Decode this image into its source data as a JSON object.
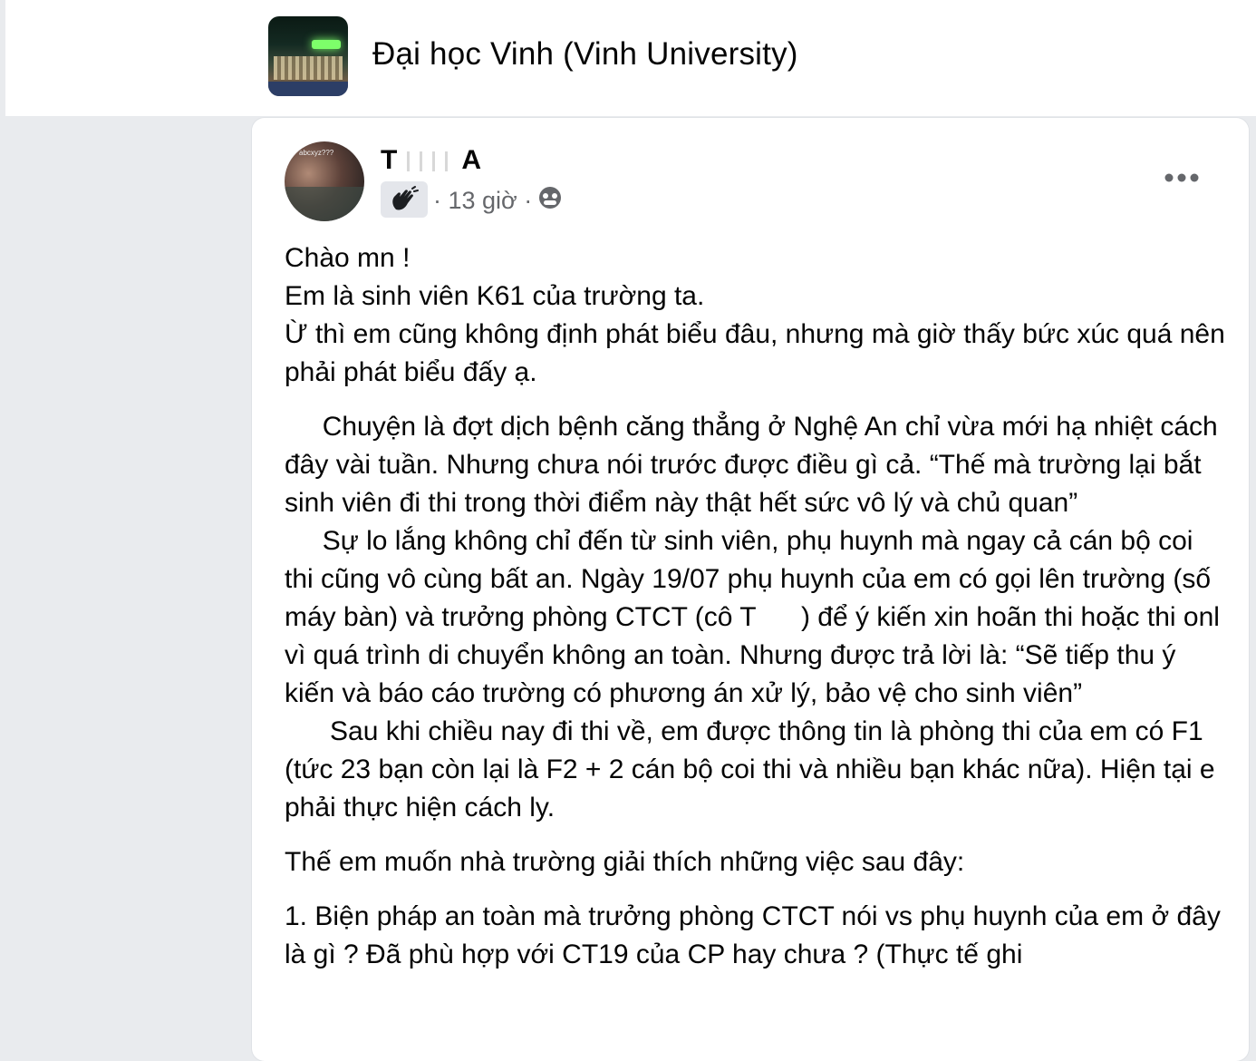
{
  "group": {
    "name": "Đại học Vinh (Vinh University)"
  },
  "post": {
    "author_name_start": "T",
    "author_name_end": "A",
    "avatar_overlay_text": "abcxyz???",
    "time": "· 13 giờ ·",
    "paragraphs": [
      "Chào mn !\nEm là sinh viên K61 của trường ta.\nỪ thì em cũng không định phát biểu đâu, nhưng mà giờ thấy bức xúc quá nên phải phát biểu đấy ạ.",
      "     Chuyện là đợt dịch bệnh căng thẳng ở Nghệ An chỉ vừa mới hạ nhiệt cách đây vài tuần. Nhưng chưa nói trước được điều gì cả. “Thế mà trường lại bắt sinh viên đi thi trong thời điểm này thật hết sức vô lý và chủ quan”\n     Sự lo lắng không chỉ đến từ sinh viên, phụ huynh mà ngay cả cán bộ coi thi cũng vô cùng bất an. Ngày 19/07 phụ huynh của em có gọi lên trường (số máy bàn) và trưởng phòng CTCT (cô T      ) để ý kiến xin hoãn thi hoặc thi onl vì quá trình di chuyển không an toàn. Nhưng được trả lời là: “Sẽ tiếp thu ý kiến và báo cáo trường có phương án xử lý, bảo vệ cho sinh viên”\n      Sau khi chiều nay đi thi về, em được thông tin là phòng thi của em có F1 (tức 23 bạn còn lại là F2 + 2 cán bộ coi thi và nhiều bạn khác nữa). Hiện tại e phải thực hiện cách ly.",
      "Thế em muốn nhà trường giải thích những việc sau đây:",
      "1. Biện pháp an toàn mà trưởng phòng CTCT nói vs phụ huynh của em ở đây là gì ? Đã phù hợp với CT19 của CP hay chưa ? (Thực tế ghi"
    ]
  },
  "icons": {
    "badge": "waving-hand-badge-icon",
    "privacy": "group-privacy-icon",
    "more": "more-options-icon"
  },
  "colors": {
    "secondary_text": "#65676b",
    "page_bg": "#e9ebee",
    "card_bg": "#ffffff"
  }
}
